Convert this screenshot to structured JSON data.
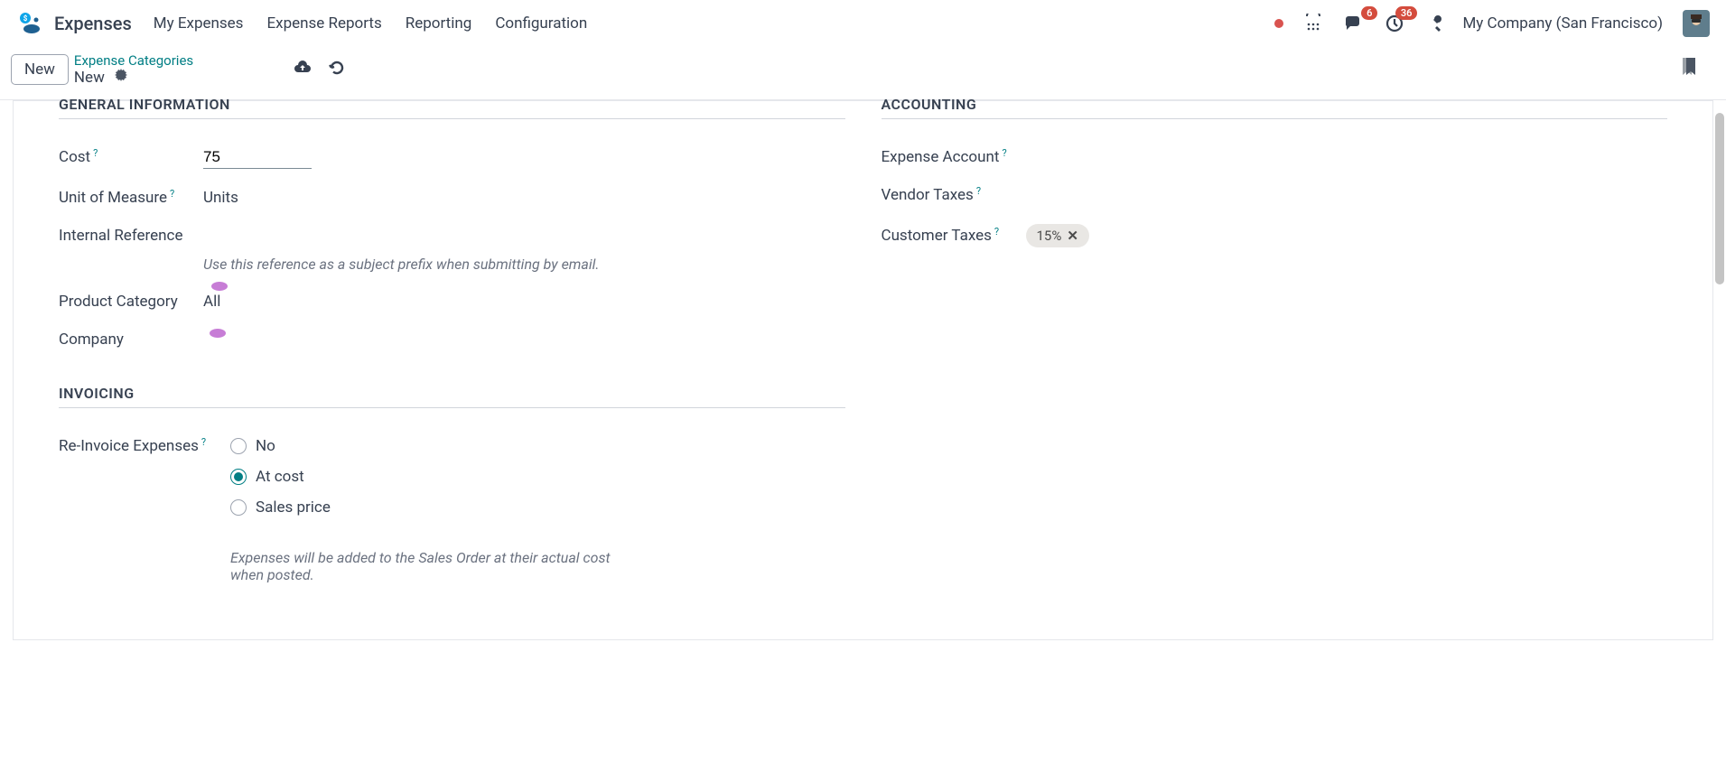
{
  "header": {
    "app_title": "Expenses",
    "nav": [
      "My Expenses",
      "Expense Reports",
      "Reporting",
      "Configuration"
    ],
    "badges": {
      "messages": "6",
      "activities": "36"
    },
    "company": "My Company (San Francisco)"
  },
  "breadcrumb": {
    "new_button": "New",
    "parent_link": "Expense Categories",
    "current": "New"
  },
  "sections": {
    "general": "GENERAL INFORMATION",
    "accounting": "ACCOUNTING",
    "invoicing": "INVOICING"
  },
  "fields": {
    "cost_label": "Cost",
    "cost_value": "75",
    "uom_label": "Unit of Measure",
    "uom_value": "Units",
    "internal_ref_label": "Internal Reference",
    "internal_ref_hint": "Use this reference as a subject prefix when submitting by email.",
    "product_category_label": "Product Category",
    "product_category_value": "All",
    "company_label": "Company",
    "expense_account_label": "Expense Account",
    "vendor_taxes_label": "Vendor Taxes",
    "customer_taxes_label": "Customer Taxes",
    "customer_taxes_tag": "15%",
    "reinvoice_label": "Re-Invoice Expenses",
    "reinvoice_options": {
      "no": "No",
      "at_cost": "At cost",
      "sales_price": "Sales price"
    },
    "reinvoice_help": "Expenses will be added to the Sales Order at their actual cost when posted."
  }
}
